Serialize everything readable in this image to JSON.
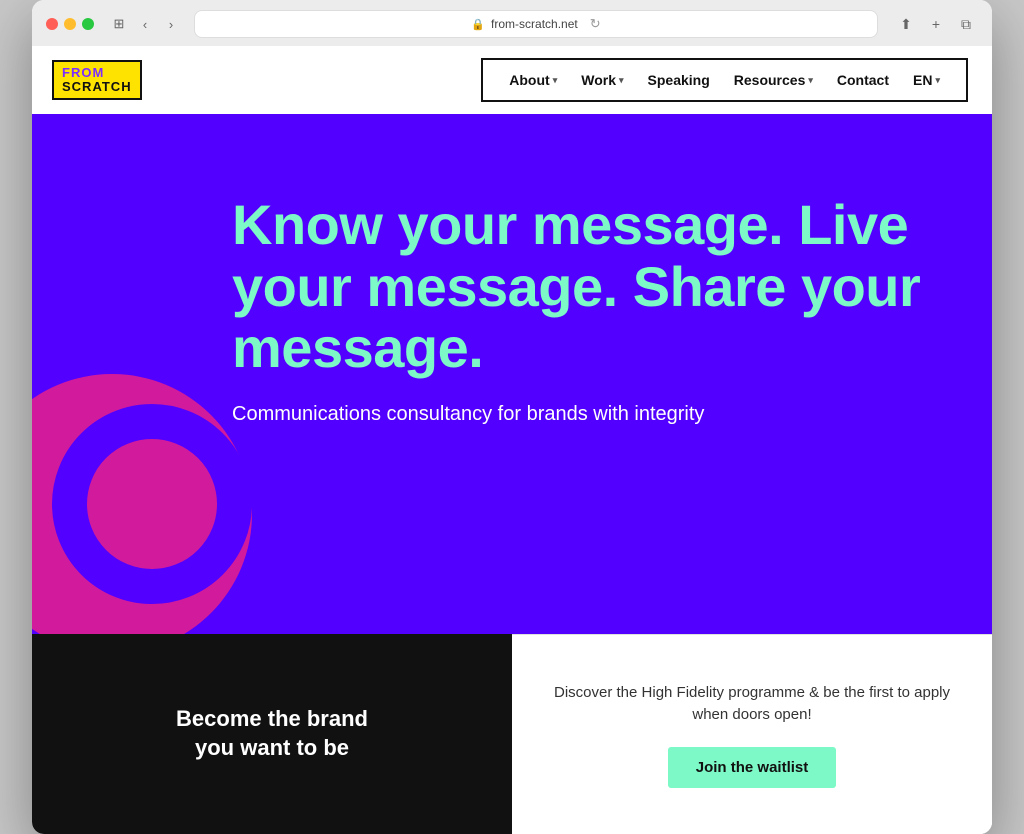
{
  "browser": {
    "url": "from-scratch.net",
    "back_label": "‹",
    "forward_label": "›",
    "reload_label": "↻",
    "share_label": "⬆",
    "add_tab_label": "+",
    "new_window_label": "⧉"
  },
  "logo": {
    "line1": "FROM",
    "line2": "SCRATCH"
  },
  "nav": {
    "items": [
      {
        "label": "About",
        "has_dropdown": true
      },
      {
        "label": "Work",
        "has_dropdown": true
      },
      {
        "label": "Speaking",
        "has_dropdown": false
      },
      {
        "label": "Resources",
        "has_dropdown": true
      },
      {
        "label": "Contact",
        "has_dropdown": false
      },
      {
        "label": "EN",
        "has_dropdown": true
      }
    ]
  },
  "hero": {
    "headline": "Know your message. Live your message. Share your message.",
    "subheadline": "Communications consultancy for brands with integrity"
  },
  "cta": {
    "black_text_line1": "Become the brand",
    "black_text_line2": "you want to be",
    "white_text": "Discover the High Fidelity programme & be the first to apply when doors open!",
    "button_label": "Join the waitlist"
  },
  "colors": {
    "hero_bg": "#5200FF",
    "hero_headline": "#7DF9C7",
    "hero_subheadline": "#ffffff",
    "logo_bg": "#FFE300",
    "logo_accent": "#7B2EFF",
    "decoration_circle": "#E91E8C",
    "cta_black_bg": "#111111",
    "cta_button": "#7DF9C7"
  }
}
